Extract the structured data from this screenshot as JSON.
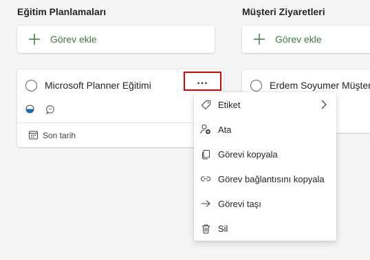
{
  "buckets": [
    {
      "title": "Eğitim Planlamaları",
      "add_label": "Görev ekle",
      "task": {
        "title": "Microsoft Planner Eğitimi",
        "more_label": "...",
        "due_label": "Son tarih"
      }
    },
    {
      "title": "Müşteri Ziyaretleri",
      "add_label": "Görev ekle",
      "task": {
        "title": "Erdem Soyumer Müşter"
      }
    }
  ],
  "menu": {
    "items": [
      {
        "label": "Etiket",
        "icon": "tag-icon",
        "has_submenu": true
      },
      {
        "label": "Ata",
        "icon": "assign-person-icon"
      },
      {
        "label": "Görevi kopyala",
        "icon": "copy-icon"
      },
      {
        "label": "Görev bağlantısını kopyala",
        "icon": "link-icon"
      },
      {
        "label": "Görevi taşı",
        "icon": "arrow-right-icon"
      },
      {
        "label": "Sil",
        "icon": "trash-icon"
      }
    ]
  },
  "colors": {
    "accent_green": "#3b7a3b",
    "highlight_red": "#e00000",
    "progress_blue": "#0f6cbd"
  }
}
